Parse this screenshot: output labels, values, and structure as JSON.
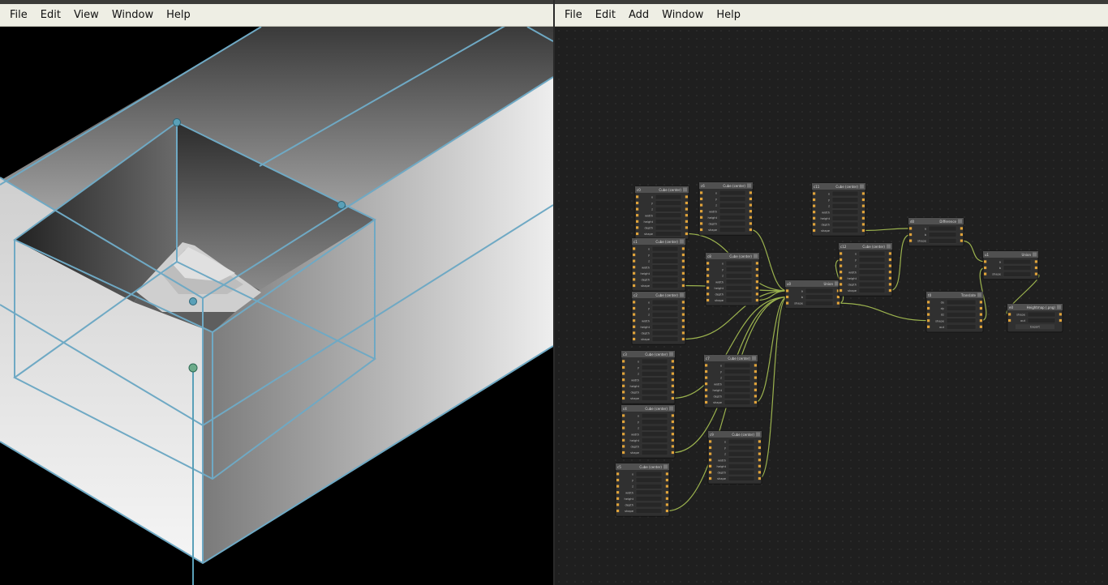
{
  "left_window": {
    "menu": [
      "File",
      "Edit",
      "View",
      "Window",
      "Help"
    ]
  },
  "right_window": {
    "menu": [
      "File",
      "Edit",
      "Add",
      "Window",
      "Help"
    ]
  },
  "colors": {
    "menubar_bg": "#eeeee4",
    "wire": "#9bb24e",
    "selection_box": "#6fa9c4",
    "handle": "#5aa0b8",
    "node_body": "#303030",
    "node_header": "#505050",
    "port": "#e0a33a"
  },
  "nodes": [
    {
      "id": "n1",
      "tag": "c0",
      "title": "Cube (center)",
      "fields": [
        "x",
        "y",
        "z",
        "width",
        "height",
        "depth",
        "shape"
      ]
    },
    {
      "id": "n2",
      "tag": "c6",
      "title": "Cube (center)",
      "fields": [
        "x",
        "y",
        "z",
        "width",
        "height",
        "depth",
        "shape"
      ]
    },
    {
      "id": "n3",
      "tag": "c1",
      "title": "Cube (center)",
      "fields": [
        "x",
        "y",
        "z",
        "width",
        "height",
        "depth",
        "shape"
      ]
    },
    {
      "id": "n4",
      "tag": "c8",
      "title": "Cube (center)",
      "fields": [
        "x",
        "y",
        "z",
        "width",
        "height",
        "depth",
        "shape"
      ]
    },
    {
      "id": "n5",
      "tag": "c2",
      "title": "Cube (center)",
      "fields": [
        "x",
        "y",
        "z",
        "width",
        "height",
        "depth",
        "shape"
      ]
    },
    {
      "id": "n6",
      "tag": "c3",
      "title": "Cube (center)",
      "fields": [
        "x",
        "y",
        "z",
        "width",
        "height",
        "depth",
        "shape"
      ]
    },
    {
      "id": "n7",
      "tag": "c7",
      "title": "Cube (center)",
      "fields": [
        "x",
        "y",
        "z",
        "width",
        "height",
        "depth",
        "shape"
      ]
    },
    {
      "id": "n8",
      "tag": "c4",
      "title": "Cube (center)",
      "fields": [
        "x",
        "y",
        "z",
        "width",
        "height",
        "depth",
        "shape"
      ]
    },
    {
      "id": "n9",
      "tag": "c9",
      "title": "Cube (center)",
      "fields": [
        "x",
        "y",
        "z",
        "width",
        "height",
        "depth",
        "shape"
      ]
    },
    {
      "id": "n10",
      "tag": "c5",
      "title": "Cube (center)",
      "fields": [
        "x",
        "y",
        "z",
        "width",
        "height",
        "depth",
        "shape"
      ]
    },
    {
      "id": "n11",
      "tag": "u0",
      "title": "Union",
      "fields": [
        "a",
        "b",
        "shape"
      ]
    },
    {
      "id": "n12",
      "tag": "c11",
      "title": "Cube (center)",
      "fields": [
        "x",
        "y",
        "z",
        "width",
        "height",
        "depth",
        "shape"
      ]
    },
    {
      "id": "n13",
      "tag": "c12",
      "title": "Cube (center)",
      "fields": [
        "x",
        "y",
        "z",
        "width",
        "height",
        "depth",
        "shape"
      ]
    },
    {
      "id": "n14",
      "tag": "d0",
      "title": "Difference",
      "fields": [
        "a",
        "b",
        "shape"
      ]
    },
    {
      "id": "n15",
      "tag": "t0",
      "title": "Translate",
      "fields": [
        "dx",
        "dy",
        "dz",
        "shape",
        "out"
      ]
    },
    {
      "id": "n16",
      "tag": "u1",
      "title": "Union",
      "fields": [
        "a",
        "b",
        "shape"
      ]
    },
    {
      "id": "n17",
      "tag": "e0",
      "title": "Heightmap (.png)",
      "fields": [
        "shape",
        "out",
        "Export"
      ]
    }
  ]
}
